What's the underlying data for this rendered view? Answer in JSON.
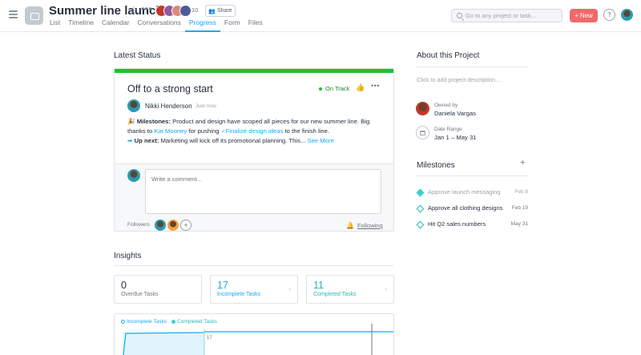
{
  "header": {
    "project_title": "Summer line launch",
    "member_count": "10",
    "share_label": "Share",
    "tabs": [
      {
        "label": "List"
      },
      {
        "label": "Timeline"
      },
      {
        "label": "Calendar"
      },
      {
        "label": "Conversations"
      },
      {
        "label": "Progress",
        "active": true
      },
      {
        "label": "Form"
      },
      {
        "label": "Files"
      }
    ],
    "search_placeholder": "Go to any project or task...",
    "new_label": "New",
    "help_label": "?"
  },
  "latest_status": {
    "section_title": "Latest Status",
    "title": "Off to a strong start",
    "status_label": "On Track",
    "status_color": "#22c02f",
    "author": "Nikki Henderson",
    "time": "Just now",
    "milestones_label": "Milestones:",
    "milestones_text_1": "Product and design have scoped all pieces for our new summer line. Big thanks to",
    "mention": "Kat Mooney",
    "milestones_text_2": "for pushing",
    "task_link": "Finalize design ideas",
    "milestones_text_3": "to the finish line.",
    "upnext_label": "Up next:",
    "upnext_text": "Marketing will kick off its promotional planning. This...",
    "see_more": "See More",
    "comment_placeholder": "Write a comment...",
    "followers_label": "Followers",
    "following_label": "Following"
  },
  "insights": {
    "section_title": "Insights",
    "stats": [
      {
        "value": "0",
        "label": "Overdue Tasks"
      },
      {
        "value": "17",
        "label": "Incomplete Tasks"
      },
      {
        "value": "11",
        "label": "Completed Tasks"
      }
    ],
    "legend": {
      "incomplete": "Incomplete Tasks",
      "completed": "Completed Tasks"
    },
    "chart_point_label": "17"
  },
  "about": {
    "section_title": "About this Project",
    "description_placeholder": "Click to add project description...",
    "owner_label": "Owned by",
    "owner_name": "Daniela Vargas",
    "date_label": "Date Range",
    "date_value": "Jan 1 – May 31"
  },
  "milestones": {
    "section_title": "Milestones",
    "items": [
      {
        "name": "Approve launch messaging",
        "date": "Feb 8",
        "done": true
      },
      {
        "name": "Approve all clothing designs",
        "date": "Feb 19",
        "done": false
      },
      {
        "name": "Hit Q2 sales numbers",
        "date": "May 31",
        "done": false
      }
    ]
  },
  "colors": {
    "accent": "#14aaf5",
    "new_button": "#f06a6a",
    "milestone": "#27b8b2"
  }
}
